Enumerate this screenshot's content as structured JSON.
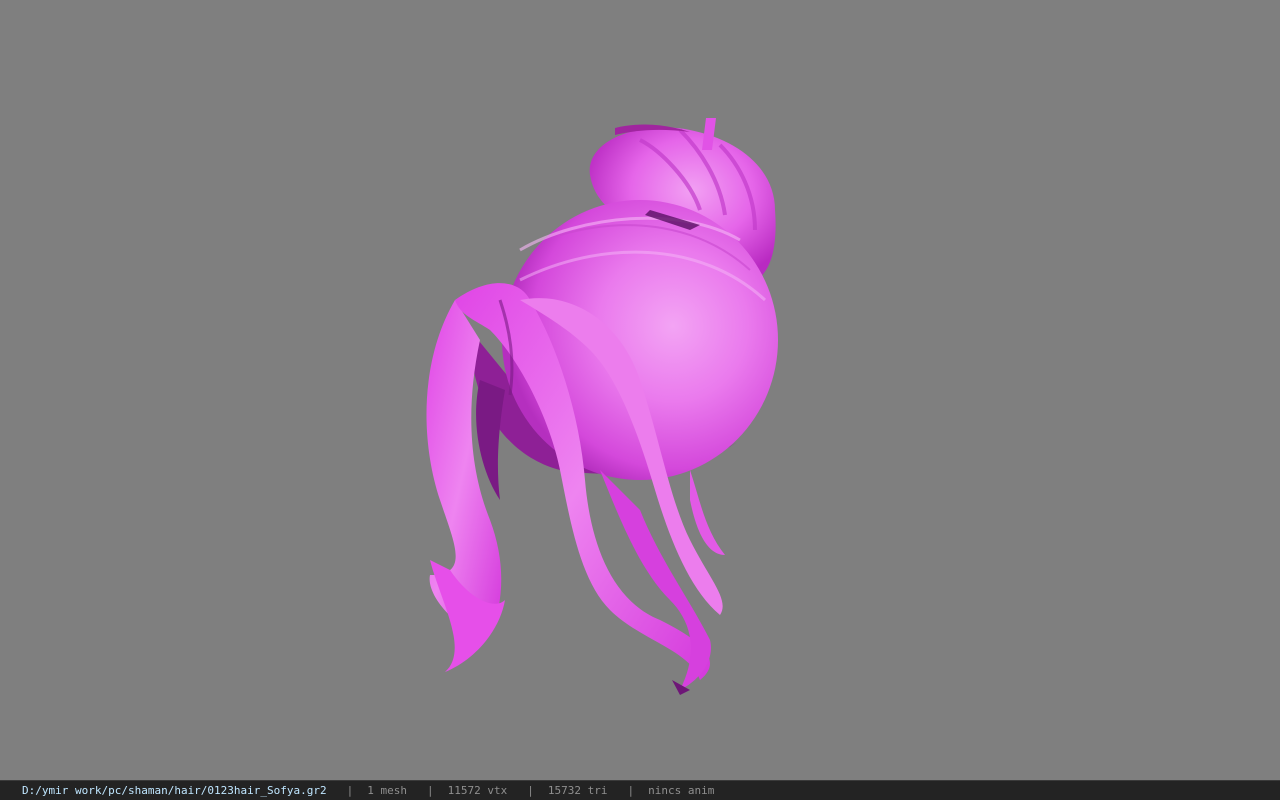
{
  "viewport": {
    "background_color": "#7f7f7f",
    "model": {
      "icon": "hair-mesh-model",
      "colors": {
        "base": "#d93ee0",
        "light": "#ee85f0",
        "bright": "#f08af2",
        "dark": "#9a1ea3",
        "shadow": "#6e1677"
      }
    }
  },
  "statusbar": {
    "file_path": "D:/ymir work/pc/shaman/hair/0123hair_Sofya.gr2",
    "separator": "|",
    "mesh_count": "1 mesh",
    "vertex_count": "11572 vtx",
    "triangle_count": "15732 tri",
    "anim_status": "nincs anim"
  }
}
